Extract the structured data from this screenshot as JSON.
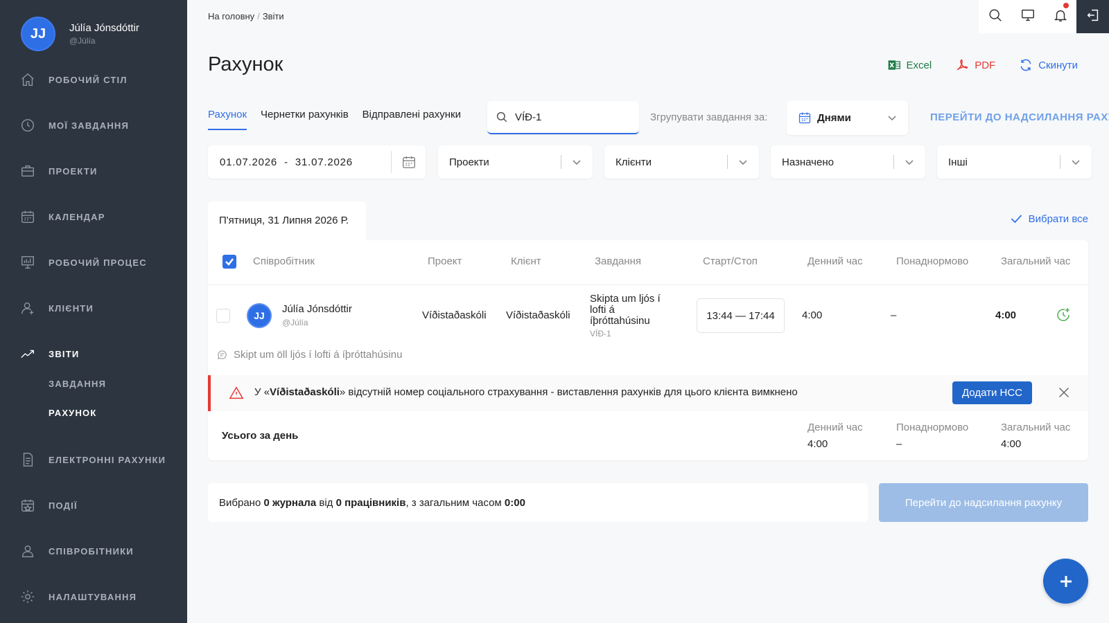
{
  "user": {
    "initials": "JJ",
    "name": "Júlía Jónsdóttir",
    "handle": "@Júlía"
  },
  "nav": {
    "items": [
      {
        "label": "РОБОЧИЙ СТІЛ",
        "icon": "home-icon"
      },
      {
        "label": "МОЇ ЗАВДАННЯ",
        "icon": "clock-icon"
      },
      {
        "label": "ПРОЕКТИ",
        "icon": "briefcase-icon"
      },
      {
        "label": "КАЛЕНДАР",
        "icon": "calendar-icon"
      },
      {
        "label": "РОБОЧИЙ ПРОЦЕС",
        "icon": "chart-board-icon"
      },
      {
        "label": "КЛІЄНТИ",
        "icon": "client-icon"
      },
      {
        "label": "ЗВІТИ",
        "icon": "trend-icon",
        "active": true
      },
      {
        "label": "ЕЛЕКТРОННІ РАХУНКИ",
        "icon": "document-icon"
      },
      {
        "label": "ПОДІЇ",
        "icon": "event-calendar-icon"
      },
      {
        "label": "СПІВРОБІТНИКИ",
        "icon": "employees-icon"
      },
      {
        "label": "НАЛАШТУВАННЯ",
        "icon": "gear-icon"
      }
    ],
    "sub_items": [
      {
        "label": "ЗАВДАННЯ"
      },
      {
        "label": "РАХУНОК",
        "active": true
      }
    ]
  },
  "breadcrumb": {
    "home": "На головну",
    "sep": "/",
    "current": "Звіти"
  },
  "page": {
    "title": "Рахунок"
  },
  "actions": {
    "excel": "Excel",
    "pdf": "PDF",
    "reset": "Скинути"
  },
  "tabs": [
    {
      "label": "Рахунок",
      "active": true
    },
    {
      "label": "Чернетки рахунків"
    },
    {
      "label": "Відправлені рахунки"
    }
  ],
  "search": {
    "value": "VÍÐ-1"
  },
  "group": {
    "label": "Згрупувати завдання за:",
    "value": "Днями"
  },
  "goto_link": "ПЕРЕЙТИ ДО НАДСИЛАННЯ РАХУНКУ",
  "filters": {
    "date_from": "01.07.2026",
    "date_sep": "-",
    "date_to": "31.07.2026",
    "projects": "Проекти",
    "clients": "Клієнти",
    "assigned": "Назначено",
    "others": "Інші"
  },
  "day": {
    "title": "П'ятниця, 31 Липня 2026 Р.",
    "select_all": "Вибрати все"
  },
  "table": {
    "headers": {
      "employee": "Співробітник",
      "project": "Проект",
      "client": "Клієнт",
      "task": "Завдання",
      "start_stop": "Старт/Стоп",
      "day_time": "Денний час",
      "overtime": "Понаднормово",
      "total": "Загальний час"
    },
    "row": {
      "avatar": "JJ",
      "name": "Júlía Jónsdóttir",
      "handle": "@Júlía",
      "project": "Víðistaðaskóli",
      "client": "Víðistaðaskóli",
      "task": "Skipta um ljós í lofti á íþróttahúsinu",
      "task_code": "VÍÐ-1",
      "start_stop": "13:44 — 17:44",
      "day_time": "4:00",
      "overtime": "–",
      "total": "4:00",
      "comment": "Skipt um öll ljós í lofti á íþróttahúsinu"
    }
  },
  "warning": {
    "prefix": "У «",
    "client": "Víðistaðaskóli",
    "suffix": "» відсутній номер соціального страхування - виставлення рахунків для цього клієнта вимкнено",
    "button": "Додати НСС"
  },
  "totals": {
    "label": "Усього за день",
    "day_time_label": "Денний час",
    "day_time": "4:00",
    "overtime_label": "Понаднормово",
    "overtime": "–",
    "total_label": "Загальний час",
    "total": "4:00"
  },
  "summary": {
    "p1": "Вибрано ",
    "journals": "0 журнала",
    "p2": " від ",
    "workers": "0 працівників",
    "p3": ", з загальним часом ",
    "time": "0:00"
  },
  "send_button": "Перейти до надсилання рахунку",
  "colors": {
    "accent": "#2f6fe6",
    "sidebar": "#2d3540",
    "danger": "#e53935",
    "success": "#4caf50"
  }
}
